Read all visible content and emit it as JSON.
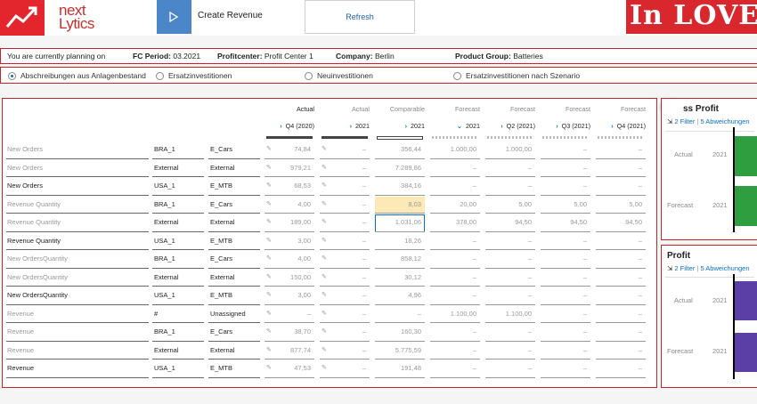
{
  "header": {
    "logo_lines": [
      "next",
      "Lytics"
    ],
    "create_label": "Create Revenue",
    "refresh_label": "Refresh",
    "banner": "In LOVE v"
  },
  "info": {
    "planning": "You are currently planning on",
    "fc_period_label": "FC Period:",
    "fc_period_value": "03.2021",
    "profitcenter_label": "Profitcenter:",
    "profitcenter_value": "Profit Center 1",
    "company_label": "Company:",
    "company_value": "Berlin",
    "product_group_label": "Product Group:",
    "product_group_value": "Batteries"
  },
  "radios": [
    {
      "label": "Abschreibungen aus Anlagenbestand",
      "selected": true
    },
    {
      "label": "Ersatzinvestitionen",
      "selected": false
    },
    {
      "label": "Neuinvestitionen",
      "selected": false
    },
    {
      "label": "Ersatzinvestitionen nach Szenario",
      "selected": false
    }
  ],
  "table": {
    "col_types": [
      "Actual",
      "Actual",
      "Comparable",
      "Forecast",
      "Forecast",
      "Forecast",
      "Forecast"
    ],
    "col_periods": [
      "Q4 (2020)",
      "2021",
      "2021",
      "2021",
      "Q2 (2021)",
      "Q3 (2021)",
      "Q4 (2021)"
    ],
    "col_chevrons": [
      "›",
      "›",
      "›",
      "⌄",
      "›",
      "›",
      "›"
    ],
    "rows": [
      {
        "measure": "New Orders",
        "entity": "BRA_1",
        "product": "E_Cars",
        "values": [
          "74,84",
          "–",
          "356,44",
          "1.000,00",
          "1.000,00",
          "–",
          "–"
        ],
        "style": "grey"
      },
      {
        "measure": "New Orders",
        "entity": "External",
        "product": "External",
        "values": [
          "979,21",
          "–",
          "7.289,86",
          "–",
          "–",
          "–",
          "–"
        ],
        "style": "grey"
      },
      {
        "measure": "New Orders",
        "entity": "USA_1",
        "product": "E_MTB",
        "values": [
          "68,53",
          "–",
          "384,16",
          "–",
          "–",
          "–",
          "–"
        ],
        "style": "dark"
      },
      {
        "measure": "Revenue Quantity",
        "entity": "BRA_1",
        "product": "E_Cars",
        "values": [
          "4,00",
          "–",
          "8,03",
          "20,00",
          "5,00",
          "5,00",
          "5,00"
        ],
        "style": "grey"
      },
      {
        "measure": "Revenue Quantity",
        "entity": "External",
        "product": "External",
        "values": [
          "189,00",
          "–",
          "1.031,06",
          "378,00",
          "94,50",
          "94,50",
          "94,50"
        ],
        "style": "grey"
      },
      {
        "measure": "Revenue Quantity",
        "entity": "USA_1",
        "product": "E_MTB",
        "values": [
          "3,00",
          "–",
          "18,26",
          "–",
          "–",
          "–",
          "–"
        ],
        "style": "dark"
      },
      {
        "measure": "New OrdersQuantity",
        "entity": "BRA_1",
        "product": "E_Cars",
        "values": [
          "4,00",
          "–",
          "858,12",
          "–",
          "–",
          "–",
          "–"
        ],
        "style": "grey"
      },
      {
        "measure": "New OrdersQuantity",
        "entity": "External",
        "product": "External",
        "values": [
          "150,00",
          "–",
          "30,12",
          "–",
          "–",
          "–",
          "–"
        ],
        "style": "grey"
      },
      {
        "measure": "New OrdersQuantity",
        "entity": "USA_1",
        "product": "E_MTB",
        "values": [
          "3,00",
          "–",
          "4,96",
          "–",
          "–",
          "–",
          "–"
        ],
        "style": "dark"
      },
      {
        "measure": "Revenue",
        "entity": "#",
        "product": "Unassigned",
        "values": [
          "–",
          "–",
          "–",
          "1.100,00",
          "1.100,00",
          "–",
          "–"
        ],
        "style": "grey"
      },
      {
        "measure": "Revenue",
        "entity": "BRA_1",
        "product": "E_Cars",
        "values": [
          "38,70",
          "–",
          "160,30",
          "–",
          "–",
          "–",
          "–"
        ],
        "style": "grey"
      },
      {
        "measure": "Revenue",
        "entity": "External",
        "product": "External",
        "values": [
          "877,74",
          "–",
          "5.775,59",
          "–",
          "–",
          "–",
          "–"
        ],
        "style": "grey"
      },
      {
        "measure": "Revenue",
        "entity": "USA_1",
        "product": "E_MTB",
        "values": [
          "47,53",
          "–",
          "191,48",
          "–",
          "–",
          "–",
          "–"
        ],
        "style": "dark"
      }
    ]
  },
  "panel1": {
    "title": "ss Profit",
    "filters": "2 Filter",
    "deviations": "5 Abweichungen",
    "row1_label": "Actual",
    "row1_year": "2021",
    "row2_label": "Forecast",
    "row2_year": "2021",
    "bar_color": "#2e9e3e"
  },
  "panel2": {
    "title": "Profit",
    "filters": "2 Filter",
    "deviations": "5 Abweichungen",
    "row1_label": "Actual",
    "row1_year": "2021",
    "row2_label": "Forecast",
    "row2_year": "2021",
    "bar_color": "#5b3fa6"
  },
  "colors": {
    "accent": "#c8232a",
    "link": "#0a6ed1",
    "highlight": "#fde9b6"
  }
}
